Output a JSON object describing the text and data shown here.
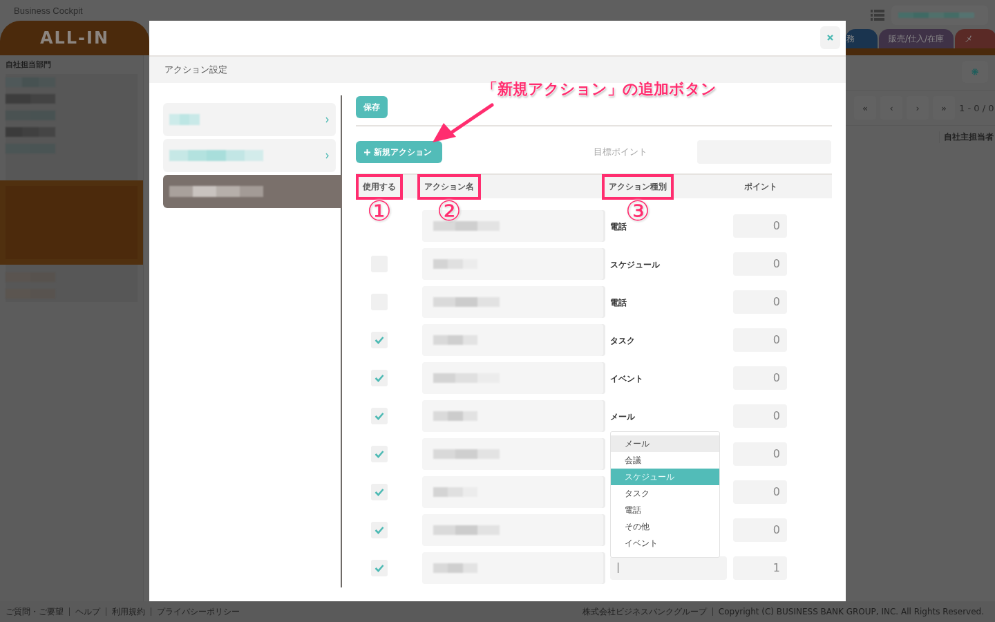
{
  "app": {
    "title": "Business Cockpit",
    "logo": "ALL-IN",
    "tabs": [
      {
        "label": "務",
        "color": "#1a344f"
      },
      {
        "label": "販売/仕入/在庫",
        "color": "#3f3247"
      },
      {
        "label": "メ",
        "color": "#5a2a26"
      }
    ],
    "sidebar": {
      "heading": "自社担当部門"
    },
    "pagination": {
      "buttons": [
        "«",
        "‹",
        "›",
        "»"
      ],
      "range": "1 - 0 / 0"
    },
    "column_header": "自社主担当者"
  },
  "modal": {
    "title": "アクション設定",
    "categories": [
      {
        "selected": false
      },
      {
        "selected": false
      },
      {
        "selected": true
      }
    ],
    "save_button": "保存",
    "new_action_button": "新規アクション",
    "target_label": "目標ポイント",
    "columns": [
      {
        "label": "使用する",
        "highlighted": true,
        "marker": "①"
      },
      {
        "label": "アクション名",
        "highlighted": true,
        "marker": "②"
      },
      {
        "label": "アクション種別",
        "highlighted": true,
        "marker": "③"
      },
      {
        "label": "ポイント",
        "highlighted": false
      }
    ],
    "rows": [
      {
        "type": "電話",
        "points": "0"
      },
      {
        "checked": false,
        "type": "スケジュール",
        "points": "0"
      },
      {
        "checked": false,
        "type": "電話",
        "points": "0"
      },
      {
        "checked": true,
        "type": "タスク",
        "points": "0"
      },
      {
        "checked": true,
        "type": "イベント",
        "points": "0"
      },
      {
        "checked": true,
        "type": "メール",
        "points": "0"
      },
      {
        "checked": true,
        "points": "0"
      },
      {
        "checked": true,
        "points": "0"
      },
      {
        "checked": true,
        "points": "0"
      },
      {
        "checked": true,
        "type_editing": true,
        "points": "1"
      }
    ],
    "dropdown": [
      {
        "label": "メール",
        "hovered": true,
        "selected": false
      },
      {
        "label": "会議",
        "hovered": false,
        "selected": false
      },
      {
        "label": "スケジュール",
        "hovered": false,
        "selected": true
      },
      {
        "label": "タスク",
        "hovered": false,
        "selected": false
      },
      {
        "label": "電話",
        "hovered": false,
        "selected": false
      },
      {
        "label": "その他",
        "hovered": false,
        "selected": false
      },
      {
        "label": "イベント",
        "hovered": false,
        "selected": false
      }
    ],
    "callout": "「新規アクション」の追加ボタン"
  },
  "footer": {
    "links": [
      "ご質問・ご要望",
      "ヘルプ",
      "利用規約",
      "プライバシーポリシー"
    ],
    "company": "株式会社ビジネスバンクグループ",
    "copyright": "Copyright (C) BUSINESS BANK GROUP, INC. All Rights Reserved."
  }
}
